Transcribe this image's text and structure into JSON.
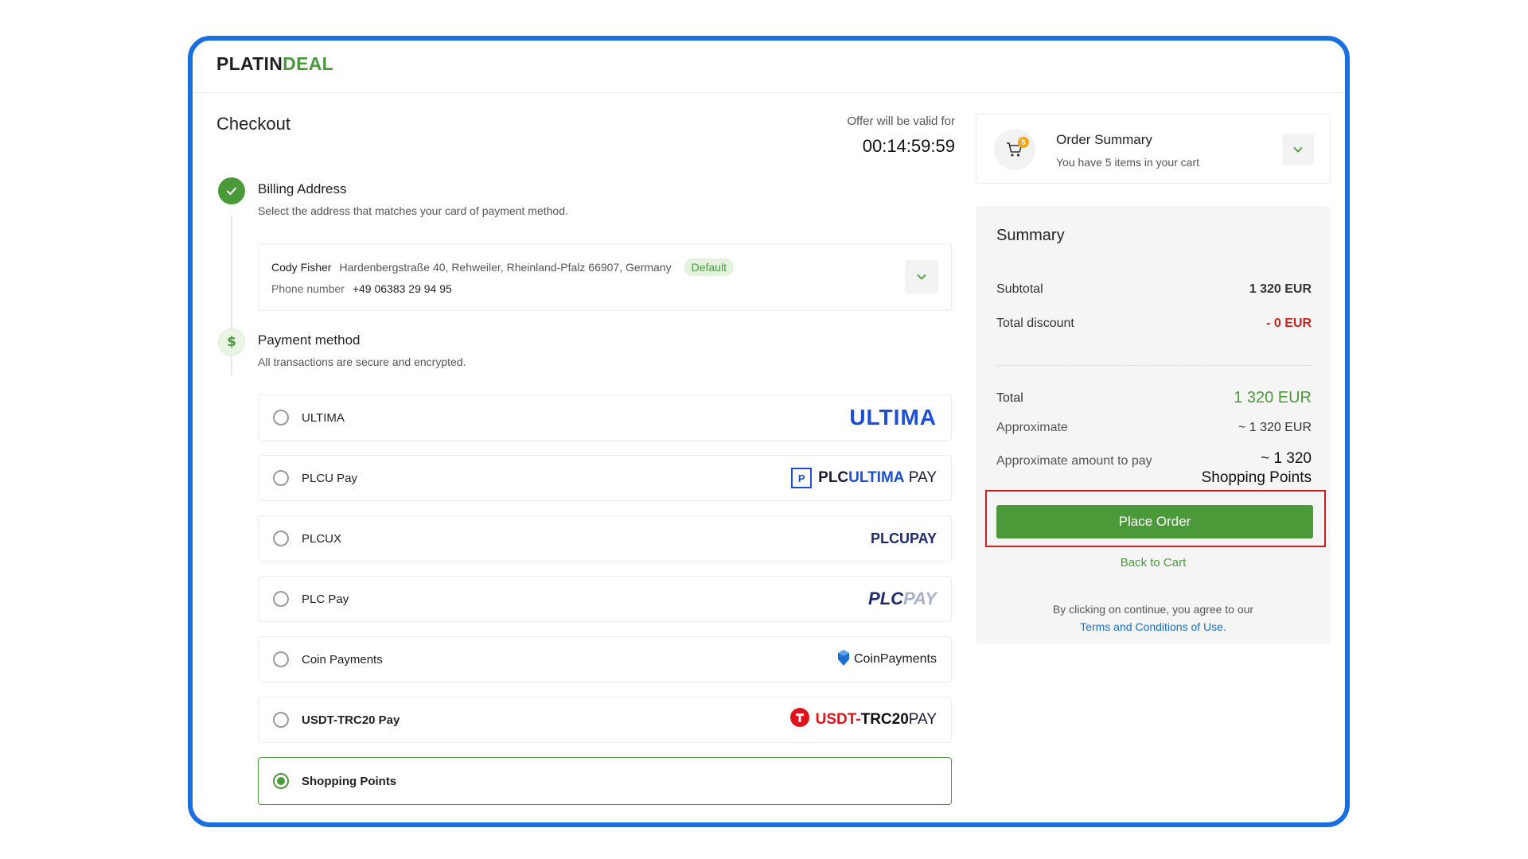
{
  "brand": {
    "part1": "PLATIN",
    "part2": "DEAL"
  },
  "checkout": {
    "title": "Checkout",
    "timer_label": "Offer will be valid for",
    "timer": "00:14:59:59"
  },
  "billing": {
    "title": "Billing Address",
    "subtitle": "Select the address that matches your card of payment method.",
    "name": "Cody Fisher",
    "address": "Hardenbergstraße 40, Rehweiler, Rheinland-Pfalz 66907, Germany",
    "badge": "Default",
    "phone_label": "Phone number",
    "phone": "+49 06383 29 94 95"
  },
  "payment": {
    "title": "Payment method",
    "subtitle": "All transactions are secure and encrypted.",
    "options": [
      {
        "label": "ULTIMA",
        "selected": false,
        "logo": "ULTIMA"
      },
      {
        "label": "PLCU Pay",
        "selected": false,
        "logo_a": "PLC",
        "logo_b": "ULTIMA",
        "logo_c": "PAY"
      },
      {
        "label": "PLCUX",
        "selected": false,
        "logo_a": "PLCU",
        "logo_b": "PAY"
      },
      {
        "label": "PLC Pay",
        "selected": false,
        "logo_a": "PLC",
        "logo_b": "PAY"
      },
      {
        "label": "Coin Payments",
        "selected": false,
        "logo": "CoinPayments"
      },
      {
        "label": "USDT-TRC20 Pay",
        "selected": false,
        "logo_a": "USDT-",
        "logo_b": "TRC20",
        "logo_c": "PAY"
      },
      {
        "label": "Shopping Points",
        "selected": true
      }
    ]
  },
  "order_summary": {
    "title": "Order Summary",
    "subtitle": "You have 5 items in your cart",
    "cart_count": "5"
  },
  "summary": {
    "title": "Summary",
    "subtitle_label": "Subtotal",
    "subtotal": "1 320 EUR",
    "discount_label": "Total discount",
    "discount": "- 0 EUR",
    "total_label": "Total",
    "total": "1 320 EUR",
    "approx_label": "Approximate",
    "approx": "~ 1 320 EUR",
    "approx_amount_label": "Approximate amount to pay",
    "approx_amount_line1": "~ 1 320",
    "approx_amount_line2": "Shopping Points",
    "place_order": "Place Order",
    "back_to_cart": "Back to Cart",
    "agree_text": "By clicking on continue, you agree to our",
    "terms": "Terms and Conditions of Use."
  },
  "colors": {
    "accent": "#4a9a3a",
    "highlight": "#cc1f1f",
    "frame": "#1a6fe0",
    "link": "#1c6fd1"
  }
}
